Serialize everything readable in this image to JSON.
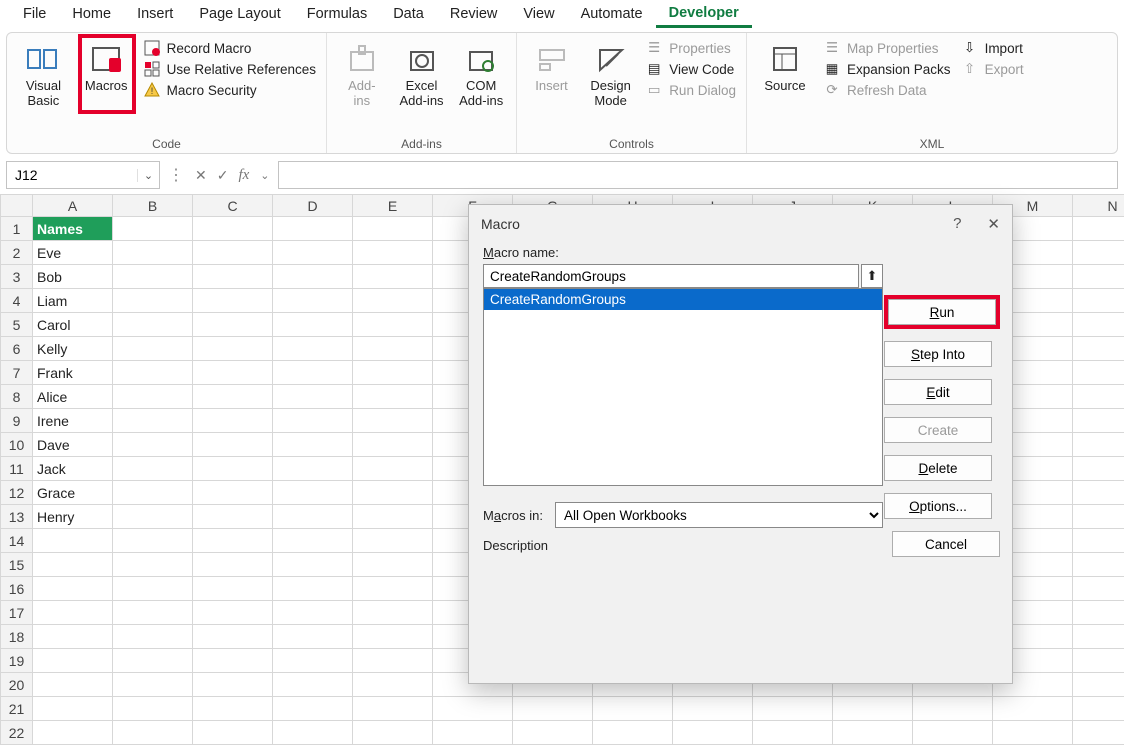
{
  "menu": {
    "tabs": [
      "File",
      "Home",
      "Insert",
      "Page Layout",
      "Formulas",
      "Data",
      "Review",
      "View",
      "Automate",
      "Developer"
    ],
    "active_index": 9
  },
  "ribbon": {
    "groups": {
      "code": {
        "label": "Code",
        "visual_basic": "Visual\nBasic",
        "macros": "Macros",
        "record_macro": "Record Macro",
        "use_relative": "Use Relative References",
        "macro_security": "Macro Security"
      },
      "addins": {
        "label": "Add-ins",
        "addins": "Add-\nins",
        "excel_addins": "Excel\nAdd-ins",
        "com_addins": "COM\nAdd-ins"
      },
      "controls": {
        "label": "Controls",
        "insert": "Insert",
        "design_mode": "Design\nMode",
        "properties": "Properties",
        "view_code": "View Code",
        "run_dialog": "Run Dialog"
      },
      "xml": {
        "label": "XML",
        "source": "Source",
        "map_properties": "Map Properties",
        "expansion_packs": "Expansion Packs",
        "refresh_data": "Refresh Data",
        "import": "Import",
        "export": "Export"
      }
    }
  },
  "formula_bar": {
    "name_box": "J12",
    "formula": ""
  },
  "sheet": {
    "columns": [
      "A",
      "B",
      "C",
      "D",
      "E",
      "F",
      "G",
      "H",
      "I",
      "J",
      "K",
      "L",
      "M",
      "N"
    ],
    "header_cell": "Names",
    "rows": [
      "Eve",
      "Bob",
      "Liam",
      "Carol",
      "Kelly",
      "Frank",
      "Alice",
      "Irene",
      "Dave",
      "Jack",
      "Grace",
      "Henry"
    ],
    "row_count": 22
  },
  "dialog": {
    "title": "Macro",
    "name_label": "Macro name:",
    "name_value": "CreateRandomGroups",
    "list": [
      "CreateRandomGroups"
    ],
    "selected_index": 0,
    "macros_in_label": "Macros in:",
    "macros_in_value": "All Open Workbooks",
    "description_label": "Description",
    "buttons": {
      "run": "Run",
      "step_into": "Step Into",
      "edit": "Edit",
      "create": "Create",
      "delete": "Delete",
      "options": "Options...",
      "cancel": "Cancel"
    }
  },
  "icons": {
    "help": "?",
    "close": "✕",
    "chevron": "⌄",
    "x": "✕",
    "check": "✓",
    "fx": "fx",
    "dots": "⋮",
    "picker": "⬆"
  }
}
